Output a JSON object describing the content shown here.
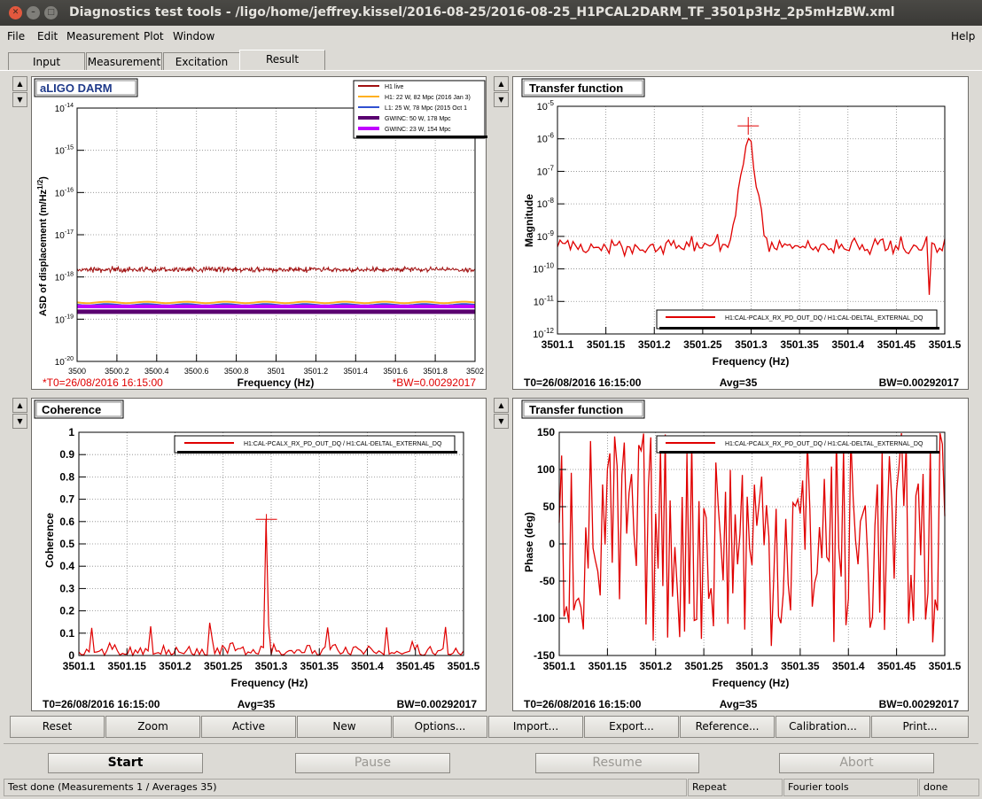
{
  "window": {
    "title": "Diagnostics test tools - /ligo/home/jeffrey.kissel/2016-08-25/2016-08-25_H1PCAL2DARM_TF_3501p3Hz_2p5mHzBW.xml",
    "close_glyph": "✕",
    "min_glyph": "–",
    "max_glyph": "□"
  },
  "menu": {
    "file": "File",
    "edit": "Edit",
    "measurement": "Measurement",
    "plot": "Plot",
    "window": "Window",
    "help": "Help"
  },
  "tabs": [
    "Input",
    "Measurement",
    "Excitation",
    "Result"
  ],
  "arrows": {
    "up": "▲",
    "down": "▼"
  },
  "panels": {
    "darm": {
      "title": "aLIGO DARM",
      "ylabel": "ASD of displacement (m/Hz",
      "ylabel_sup": "1/2",
      "ylabel_end": ")",
      "xlabel": "Frequency (Hz)",
      "t0": "*T0=26/08/2016 16:15:00",
      "bw": "*BW=0.00292017",
      "xticks": [
        "3500",
        "3500.2",
        "3500.4",
        "3500.6",
        "3500.8",
        "3501",
        "3501.2",
        "3501.4",
        "3501.6",
        "3501.8",
        "3502"
      ],
      "yticks": [
        "-14",
        "-15",
        "-16",
        "-17",
        "-18",
        "-19",
        "-20"
      ],
      "ybase": "10",
      "legend": [
        "H1 live",
        "H1: 22 W, 82 Mpc (2016 Jan 3)",
        "L1: 25 W, 78 Mpc (2015 Oct 1",
        "GWINC: 50 W, 178 Mpc",
        "GWINC: 23 W, 154 Mpc"
      ]
    },
    "tfmag": {
      "title": "Transfer function",
      "ylabel": "Magnitude",
      "xlabel": "Frequency (Hz)",
      "t0": "T0=26/08/2016 16:15:00",
      "avg": "Avg=35",
      "bw": "BW=0.00292017",
      "xticks": [
        "3501.1",
        "3501.15",
        "3501.2",
        "3501.25",
        "3501.3",
        "3501.35",
        "3501.4",
        "3501.45",
        "3501.5"
      ],
      "yticks": [
        "-5",
        "-6",
        "-7",
        "-8",
        "-9",
        "-10",
        "-11",
        "-12"
      ],
      "ybase": "10",
      "legend": "H1:CAL-PCALX_RX_PD_OUT_DQ / H1:CAL-DELTAL_EXTERNAL_DQ"
    },
    "coh": {
      "title": "Coherence",
      "ylabel": "Coherence",
      "xlabel": "Frequency (Hz)",
      "t0": "T0=26/08/2016 16:15:00",
      "avg": "Avg=35",
      "bw": "BW=0.00292017",
      "xticks": [
        "3501.1",
        "3501.15",
        "3501.2",
        "3501.25",
        "3501.3",
        "3501.35",
        "3501.4",
        "3501.45",
        "3501.5"
      ],
      "yticks": [
        "1",
        "0.9",
        "0.8",
        "0.7",
        "0.6",
        "0.5",
        "0.4",
        "0.3",
        "0.2",
        "0.1",
        "0"
      ],
      "legend": "H1:CAL-PCALX_RX_PD_OUT_DQ / H1:CAL-DELTAL_EXTERNAL_DQ"
    },
    "tfphase": {
      "title": "Transfer function",
      "ylabel": "Phase (deg)",
      "xlabel": "Frequency (Hz)",
      "t0": "T0=26/08/2016 16:15:00",
      "avg": "Avg=35",
      "bw": "BW=0.00292017",
      "xticks": [
        "3501.1",
        "3501.15",
        "3501.2",
        "3501.25",
        "3501.3",
        "3501.35",
        "3501.4",
        "3501.45",
        "3501.5"
      ],
      "yticks": [
        "150",
        "100",
        "50",
        "0",
        "-50",
        "-100",
        "-150"
      ],
      "legend": "H1:CAL-PCALX_RX_PD_OUT_DQ / H1:CAL-DELTAL_EXTERNAL_DQ"
    }
  },
  "toolbar": [
    "Reset",
    "Zoom",
    "Active",
    "New",
    "Options...",
    "Import...",
    "Export...",
    "Reference...",
    "Calibration...",
    "Print..."
  ],
  "actions": {
    "start": "Start",
    "pause": "Pause",
    "resume": "Resume",
    "abort": "Abort"
  },
  "status": {
    "message": "Test done (Measurements 1 / Averages 35)",
    "mode": "Repeat",
    "tool": "Fourier tools",
    "state": "done"
  },
  "colors": {
    "trace": "#e00000",
    "h1live": "#a01010",
    "h1ref": "#ffb020",
    "l1ref": "#3050d0",
    "gwinc50": "#5a0070",
    "gwinc23": "#c000ff",
    "title_blue": "#1f3a8a"
  },
  "chart_data": [
    {
      "type": "line",
      "title": "aLIGO DARM",
      "xlabel": "Frequency (Hz)",
      "ylabel": "ASD of displacement (m/Hz^1/2)",
      "xlim": [
        3500,
        3502
      ],
      "ylim": [
        1e-20,
        1e-14
      ],
      "yscale": "log",
      "grid": true,
      "legend_position": "top-right",
      "series": [
        {
          "name": "H1 live",
          "approx_level": 1.5e-18
        },
        {
          "name": "H1: 22 W, 82 Mpc (2016 Jan 3)",
          "approx_level": 2.5e-19
        },
        {
          "name": "L1: 25 W, 78 Mpc (2015 Oct 1",
          "approx_level": 2.2e-19
        },
        {
          "name": "GWINC: 50 W, 178 Mpc",
          "approx_level": 1.5e-19
        },
        {
          "name": "GWINC: 23 W, 154 Mpc",
          "approx_level": 2e-19
        }
      ]
    },
    {
      "type": "line",
      "title": "Transfer function",
      "xlabel": "Frequency (Hz)",
      "ylabel": "Magnitude",
      "xlim": [
        3501.1,
        3501.5
      ],
      "ylim": [
        1e-12,
        1e-05
      ],
      "yscale": "log",
      "grid": true,
      "legend_position": "bottom-right",
      "series": [
        {
          "name": "H1:CAL-PCALX_RX_PD_OUT_DQ / H1:CAL-DELTAL_EXTERNAL_DQ",
          "approx_floor": 5e-10,
          "peak_x": 3501.3,
          "peak_y": 2.5e-06
        }
      ]
    },
    {
      "type": "line",
      "title": "Coherence",
      "xlabel": "Frequency (Hz)",
      "ylabel": "Coherence",
      "xlim": [
        3501.1,
        3501.5
      ],
      "ylim": [
        0,
        1
      ],
      "grid": true,
      "legend_position": "top-right",
      "series": [
        {
          "name": "H1:CAL-PCALX_RX_PD_OUT_DQ / H1:CAL-DELTAL_EXTERNAL_DQ",
          "approx_floor": 0.05,
          "peak_x": 3501.295,
          "peak_y": 0.61
        }
      ]
    },
    {
      "type": "line",
      "title": "Transfer function",
      "xlabel": "Frequency (Hz)",
      "ylabel": "Phase (deg)",
      "xlim": [
        3501.1,
        3501.5
      ],
      "ylim": [
        -180,
        180
      ],
      "grid": true,
      "legend_position": "top-right",
      "series": [
        {
          "name": "H1:CAL-PCALX_RX_PD_OUT_DQ / H1:CAL-DELTAL_EXTERNAL_DQ",
          "range": [
            -180,
            180
          ]
        }
      ]
    }
  ]
}
